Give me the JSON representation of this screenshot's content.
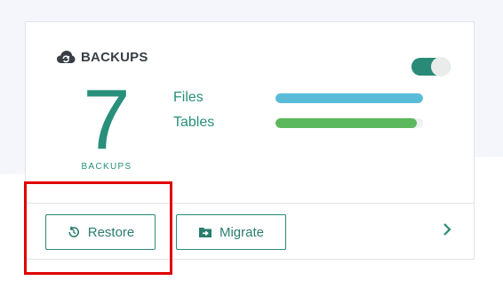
{
  "card": {
    "title": "BACKUPS",
    "title_icon": "cloud-sync-icon",
    "toggle_state": "on",
    "count": "7",
    "count_caption": "BACKUPS"
  },
  "progress": [
    {
      "label": "Files",
      "fill": 1.0,
      "color": "#5bbcd9"
    },
    {
      "label": "Tables",
      "fill": 0.96,
      "color": "#5cb85c"
    }
  ],
  "actions": {
    "restore_label": "Restore",
    "restore_icon": "restore-icon",
    "migrate_label": "Migrate",
    "migrate_icon": "folder-arrow-icon",
    "next_icon": "chevron-right-icon"
  },
  "colors": {
    "accent": "#278f7a",
    "highlight": "#e00000"
  }
}
